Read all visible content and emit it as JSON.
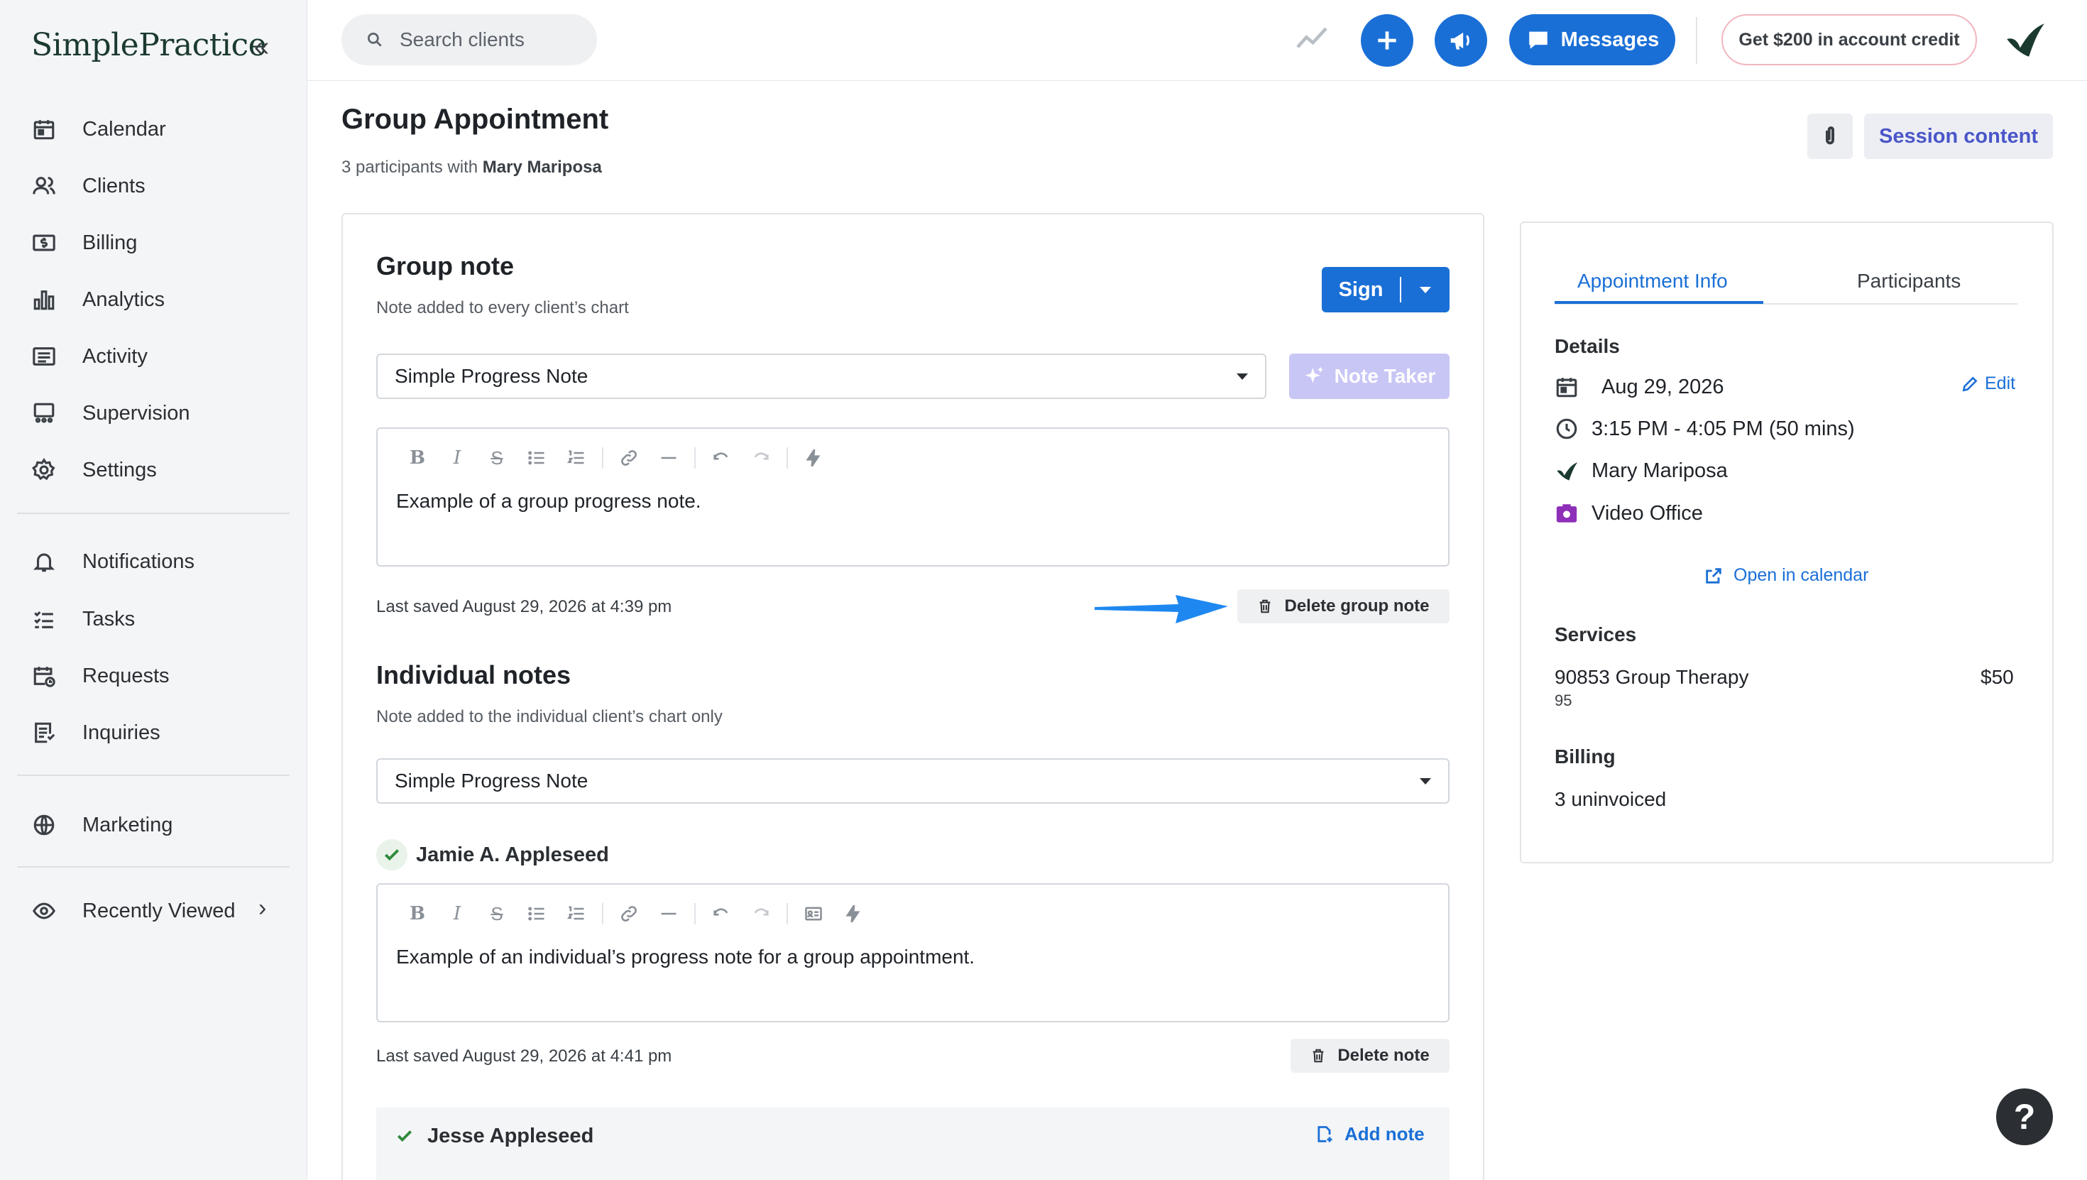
{
  "brand": {
    "logo_text": "SimplePractice",
    "collapse_glyph": "«"
  },
  "sidebar": {
    "items": [
      {
        "label": "Calendar",
        "icon": "calendar-icon"
      },
      {
        "label": "Clients",
        "icon": "clients-icon"
      },
      {
        "label": "Billing",
        "icon": "billing-icon"
      },
      {
        "label": "Analytics",
        "icon": "analytics-icon"
      },
      {
        "label": "Activity",
        "icon": "activity-icon"
      },
      {
        "label": "Supervision",
        "icon": "supervision-icon"
      },
      {
        "label": "Settings",
        "icon": "settings-icon"
      }
    ],
    "items2": [
      {
        "label": "Notifications",
        "icon": "bell-icon"
      },
      {
        "label": "Tasks",
        "icon": "tasks-icon"
      },
      {
        "label": "Requests",
        "icon": "requests-icon"
      },
      {
        "label": "Inquiries",
        "icon": "inquiries-icon"
      }
    ],
    "marketing": {
      "label": "Marketing",
      "icon": "globe-icon"
    },
    "recently_viewed": {
      "label": "Recently Viewed",
      "icon": "eye-icon",
      "chevron": "›"
    }
  },
  "topbar": {
    "search_placeholder": "Search clients",
    "messages_label": "Messages",
    "credit_label": "Get $200 in account credit"
  },
  "page": {
    "title": "Group Appointment",
    "subtitle_prefix": "3 participants with ",
    "subtitle_name": "Mary Mariposa",
    "session_content_label": "Session content"
  },
  "group_note": {
    "title": "Group note",
    "subtitle": "Note added to every client’s chart",
    "sign_label": "Sign",
    "template": "Simple Progress Note",
    "note_taker_label": "Note Taker",
    "body": "Example of a group progress note.",
    "last_saved": "Last saved August 29, 2026 at 4:39 pm",
    "delete_label": "Delete group note"
  },
  "individual_notes": {
    "title": "Individual notes",
    "subtitle": "Note added to the individual client’s chart only",
    "template": "Simple Progress Note",
    "client1": {
      "name": "Jamie A. Appleseed",
      "body": "Example of an individual’s progress note for a group appointment.",
      "last_saved": "Last saved August 29, 2026 at 4:41 pm",
      "delete_label": "Delete note"
    },
    "client2": {
      "name": "Jesse Appleseed",
      "add_note_label": "Add note"
    }
  },
  "side_panel": {
    "tabs": [
      {
        "label": "Appointment Info",
        "active": true
      },
      {
        "label": "Participants",
        "active": false
      }
    ],
    "details_heading": "Details",
    "edit_label": "Edit",
    "date": "Aug 29, 2026",
    "time": "3:15 PM - 4:05 PM (50 mins)",
    "clinician": "Mary Mariposa",
    "location": "Video Office",
    "open_calendar_label": "Open in calendar",
    "services_heading": "Services",
    "service_name": "90853 Group Therapy",
    "service_price": "$50",
    "service_code": "95",
    "billing_heading": "Billing",
    "billing_status": "3 uninvoiced"
  },
  "help_label": "?",
  "colors": {
    "accent": "#1a6fd6",
    "purple": "#4a56c8",
    "note_taker": "#c8c6f5",
    "video": "#8e2fb8"
  }
}
